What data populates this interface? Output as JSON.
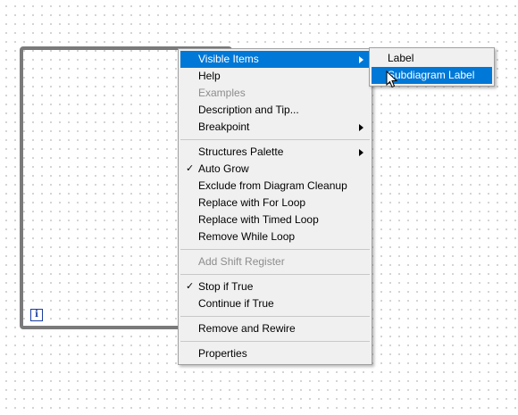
{
  "context_menu": {
    "visible_items": "Visible Items",
    "help": "Help",
    "examples": "Examples",
    "description_and_tip": "Description and Tip...",
    "breakpoint": "Breakpoint",
    "structures_palette": "Structures Palette",
    "auto_grow": "Auto Grow",
    "exclude_from_cleanup": "Exclude from Diagram Cleanup",
    "replace_with_for_loop": "Replace with For Loop",
    "replace_with_timed_loop": "Replace with Timed Loop",
    "remove_while_loop": "Remove While Loop",
    "add_shift_register": "Add Shift Register",
    "stop_if_true": "Stop if True",
    "continue_if_true": "Continue if True",
    "remove_and_rewire": "Remove and Rewire",
    "properties": "Properties",
    "checkmark_glyph": "✓"
  },
  "submenu": {
    "label": "Label",
    "subdiagram_label": "Subdiagram Label"
  },
  "loop": {
    "iteration_terminal": "i"
  },
  "colors": {
    "highlight": "#0078d7",
    "menu_bg": "#f0f0f0",
    "loop_border": "#7a7a7a",
    "disabled_text": "#8d8d8d"
  }
}
